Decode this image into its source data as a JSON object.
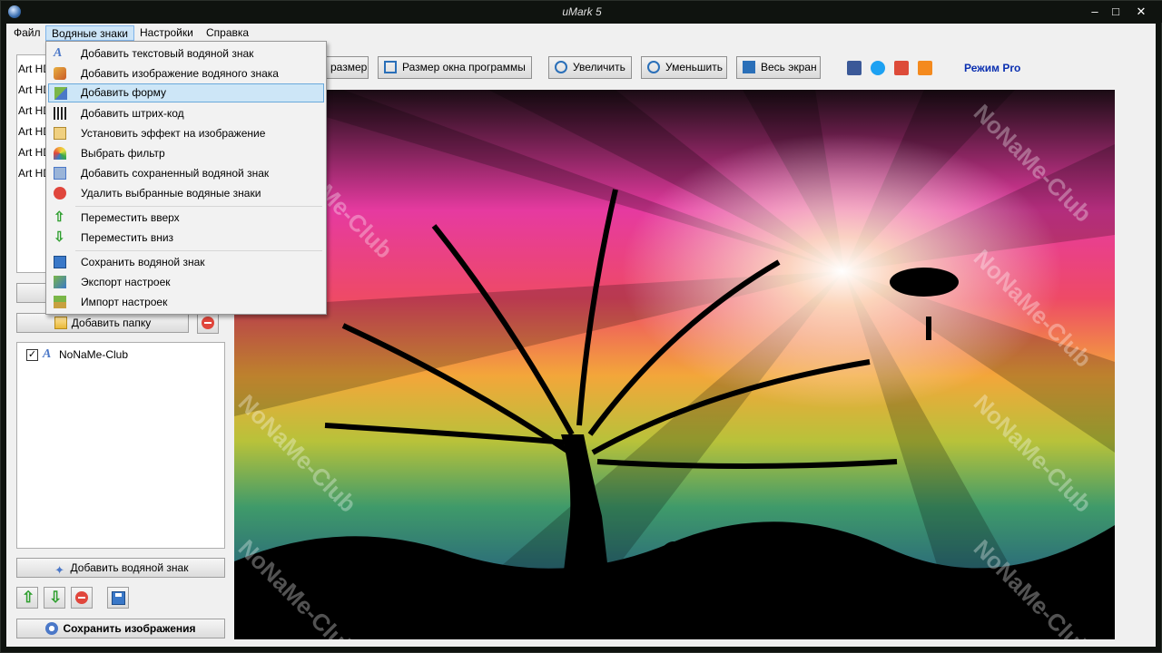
{
  "window": {
    "title": "uMark 5"
  },
  "menubar": {
    "items": [
      "Файл",
      "Водяные знаки",
      "Настройки",
      "Справка"
    ]
  },
  "dropdown": {
    "items": [
      {
        "label": "Добавить текстовый водяной знак",
        "icon": "text-icon"
      },
      {
        "label": "Добавить изображение водяного знака",
        "icon": "image-icon"
      },
      {
        "label": "Добавить форму",
        "icon": "shape-icon"
      },
      {
        "label": "Добавить штрих-код",
        "icon": "barcode-icon"
      },
      {
        "label": "Установить эффект на изображение",
        "icon": "effect-icon"
      },
      {
        "label": "Выбрать фильтр",
        "icon": "rainbow-icon"
      },
      {
        "label": "Добавить сохраненный водяной знак",
        "icon": "saved-watermark-icon"
      },
      {
        "label": "Удалить выбранные водяные знаки",
        "icon": "delete-icon"
      },
      {
        "label": "Переместить вверх",
        "icon": "arrow-up-icon"
      },
      {
        "label": "Переместить вниз",
        "icon": "arrow-down-icon"
      },
      {
        "label": "Сохранить водяной знак",
        "icon": "save-icon"
      },
      {
        "label": "Экспорт настроек",
        "icon": "export-icon"
      },
      {
        "label": "Импорт настроек",
        "icon": "import-icon"
      }
    ]
  },
  "file_list": {
    "items": [
      "Art HD",
      "Art HD",
      "Art HD",
      "Art HD",
      "Art HD",
      "Art HD"
    ]
  },
  "left": {
    "add_folder": "Добавить папку",
    "watermark_item": "NoNaMe-Club",
    "add_watermark": "Добавить водяной знак",
    "save_images": "Сохранить изображения"
  },
  "toolbar": {
    "actual_size": "размер",
    "fit_window": "Размер окна программы",
    "zoom_in": "Увеличить",
    "zoom_out": "Уменьшить",
    "fullscreen": "Весь экран",
    "pro_mode": "Режим Pro"
  },
  "preview": {
    "watermark": "NoNaMe-Club"
  },
  "colors": {
    "accent": "#0a2fb0",
    "menu_highlight": "#cde6f7"
  }
}
